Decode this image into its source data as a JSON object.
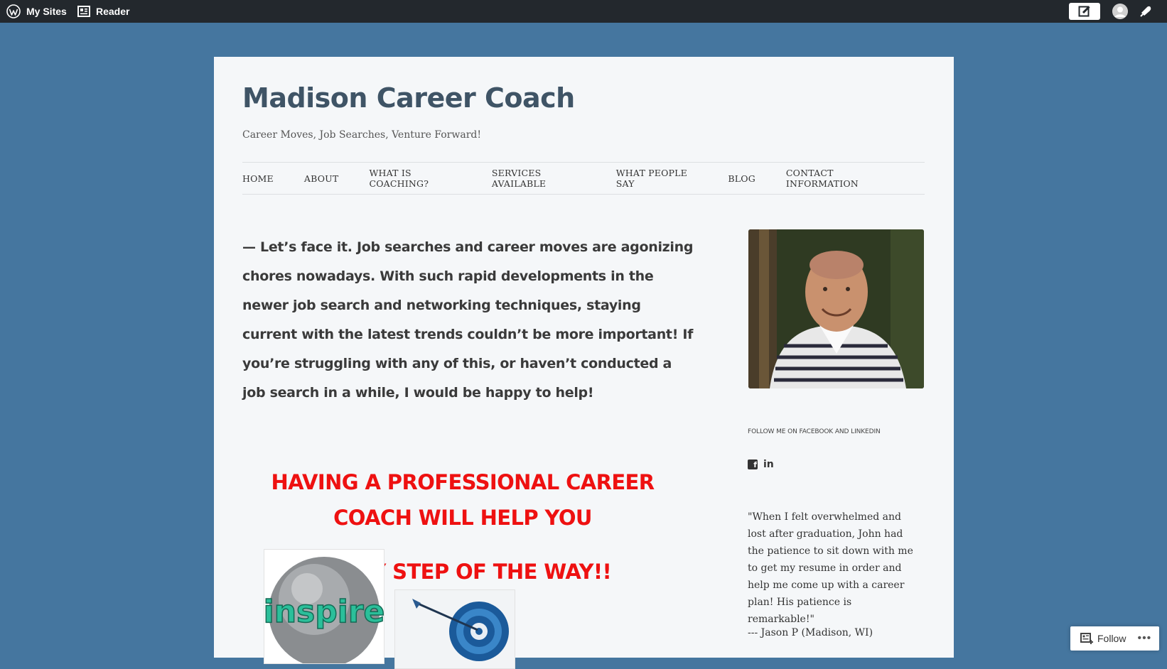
{
  "admin_bar": {
    "my_sites": "My Sites",
    "reader": "Reader"
  },
  "site": {
    "title": "Madison Career Coach",
    "description": "Career Moves, Job Searches, Venture Forward!"
  },
  "nav": {
    "items": [
      "HOME",
      "ABOUT",
      "WHAT IS COACHING?",
      "SERVICES AVAILABLE",
      "WHAT PEOPLE SAY",
      "BLOG",
      "CONTACT INFORMATION"
    ]
  },
  "content": {
    "intro": "— Let’s face it.  Job searches and career moves are agonizing chores nowadays.  With such rapid developments in the newer job search and networking techniques, staying current with the latest trends couldn’t be more important! If you’re struggling with any of this, or haven’t conducted a job search in a while, I would be happy to help!",
    "headline_1": "HAVING A PROFESSIONAL CAREER COACH WILL HELP YOU",
    "headline_2": "EVERY STEP OF THE WAY!!",
    "inspire_image_text": "inspire"
  },
  "sidebar": {
    "social_title": "FOLLOW ME ON FACEBOOK AND LINKEDIN",
    "facebook_glyph": "f",
    "linkedin_glyph": "in",
    "quote": "\"When I felt overwhelmed and lost after graduation, John had the patience to sit down with me to get my resume in order and help me come up with a career plan! His patience is remarkable!\"",
    "quote_author": "--- Jason P (Madison, WI)"
  },
  "follow": {
    "label": "Follow",
    "more": "•••"
  },
  "colors": {
    "background": "#45769f",
    "admin_bar": "#23282d",
    "headline_red": "#ee1111",
    "title": "#3f5466"
  }
}
